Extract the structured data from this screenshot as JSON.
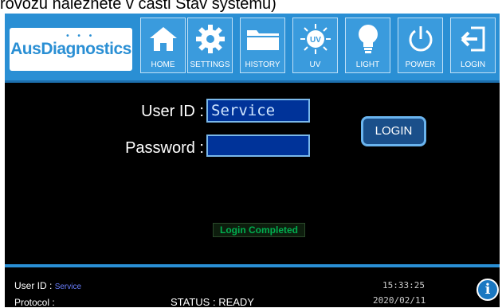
{
  "caption": "rovozu naleznete v části Stav systému)",
  "brand": {
    "name": "AusDiagnostics",
    "dots": "• • •"
  },
  "nav": [
    {
      "label": "HOME",
      "icon": "home-icon"
    },
    {
      "label": "SETTINGS",
      "icon": "gear-icon"
    },
    {
      "label": "HISTORY",
      "icon": "folder-icon"
    },
    {
      "label": "UV",
      "icon": "uv-lamp-icon"
    },
    {
      "label": "LIGHT",
      "icon": "lightbulb-icon"
    },
    {
      "label": "POWER",
      "icon": "power-icon"
    },
    {
      "label": "LOGIN",
      "icon": "login-icon"
    }
  ],
  "form": {
    "user_id_label": "User ID :",
    "user_id_value": "Service",
    "password_label": "Password :",
    "password_value": "",
    "login_button": "LOGIN",
    "message": "Login Completed"
  },
  "footer": {
    "user_id_label": "User ID :",
    "user_id_value": "Service",
    "protocol_label": "Protocol :",
    "protocol_value": "",
    "status": "STATUS : READY",
    "time": "15:33:25",
    "date": "2020/02/11"
  },
  "colors": {
    "accent": "#2a8fd4",
    "field_bg": "#003399",
    "success": "#00b050"
  }
}
